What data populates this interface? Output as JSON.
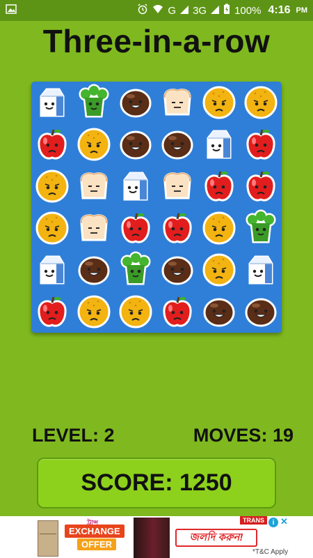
{
  "status_bar": {
    "network": "G",
    "network2": "3G",
    "battery": "100%",
    "time": "4:16",
    "ampm": "PM"
  },
  "title": "Three-in-a-row",
  "board": {
    "rows": [
      [
        "milk",
        "broccoli",
        "coconut",
        "bread",
        "orange",
        "orange"
      ],
      [
        "apple",
        "orange",
        "coconut",
        "coconut",
        "milk",
        "apple"
      ],
      [
        "orange",
        "bread",
        "milk",
        "bread",
        "apple",
        "apple"
      ],
      [
        "orange",
        "bread",
        "apple",
        "apple",
        "orange",
        "broccoli"
      ],
      [
        "milk",
        "coconut",
        "broccoli",
        "coconut",
        "orange",
        "milk"
      ],
      [
        "apple",
        "orange",
        "orange",
        "apple",
        "coconut",
        "coconut"
      ]
    ]
  },
  "colors": {
    "background": "#7fb91f",
    "board": "#2f7fd8",
    "score_button": "#8dd11c"
  },
  "level": {
    "label": "LEVEL",
    "value": "2"
  },
  "moves": {
    "label": "MOVES",
    "value": "19"
  },
  "score": {
    "text": "SCORE: 1250"
  },
  "ad": {
    "brand": "ট্রান্স",
    "offer_line1": "EXCHANGE",
    "offer_line2": "OFFER",
    "cta": "জলদি করুন!",
    "tag": "TRANS",
    "tc": "*T&C Apply",
    "info": "i",
    "close": "✕"
  }
}
